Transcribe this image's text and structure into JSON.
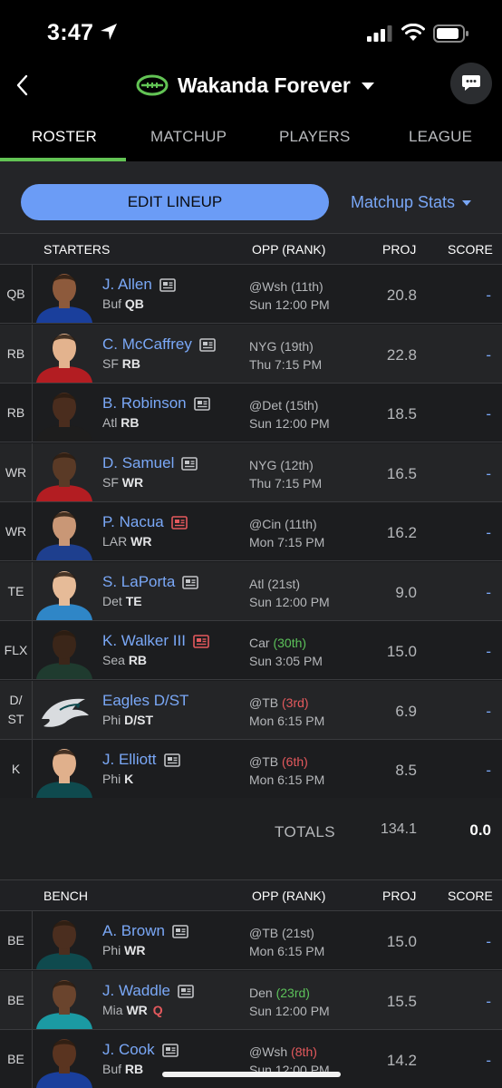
{
  "status_bar": {
    "time": "3:47"
  },
  "header": {
    "team_name": "Wakanda Forever"
  },
  "tabs": [
    {
      "label": "ROSTER",
      "active": true
    },
    {
      "label": "MATCHUP",
      "active": false
    },
    {
      "label": "PLAYERS",
      "active": false
    },
    {
      "label": "LEAGUE",
      "active": false
    }
  ],
  "toolbar": {
    "edit_label": "EDIT LINEUP",
    "stats_label": "Matchup Stats"
  },
  "starters_header": {
    "section": "STARTERS",
    "opp": "OPP (RANK)",
    "proj": "PROJ",
    "score": "SCORE"
  },
  "starters": [
    {
      "slot": "QB",
      "name": "J. Allen",
      "team": "Buf",
      "pos": "QB",
      "news": "normal",
      "opp": "@Wsh",
      "rank": "(11th)",
      "rank_color": "neutral",
      "game": "Sun 12:00 PM",
      "proj": "20.8",
      "score": "-"
    },
    {
      "slot": "RB",
      "name": "C. McCaffrey",
      "team": "SF",
      "pos": "RB",
      "news": "normal",
      "opp": "NYG",
      "rank": "(19th)",
      "rank_color": "neutral",
      "game": "Thu 7:15 PM",
      "proj": "22.8",
      "score": "-"
    },
    {
      "slot": "RB",
      "name": "B. Robinson",
      "team": "Atl",
      "pos": "RB",
      "news": "normal",
      "opp": "@Det",
      "rank": "(15th)",
      "rank_color": "neutral",
      "game": "Sun 12:00 PM",
      "proj": "18.5",
      "score": "-"
    },
    {
      "slot": "WR",
      "name": "D. Samuel",
      "team": "SF",
      "pos": "WR",
      "news": "normal",
      "opp": "NYG",
      "rank": "(12th)",
      "rank_color": "neutral",
      "game": "Thu 7:15 PM",
      "proj": "16.5",
      "score": "-"
    },
    {
      "slot": "WR",
      "name": "P. Nacua",
      "team": "LAR",
      "pos": "WR",
      "news": "red",
      "opp": "@Cin",
      "rank": "(11th)",
      "rank_color": "neutral",
      "game": "Mon 7:15 PM",
      "proj": "16.2",
      "score": "-"
    },
    {
      "slot": "TE",
      "name": "S. LaPorta",
      "team": "Det",
      "pos": "TE",
      "news": "normal",
      "opp": "Atl",
      "rank": "(21st)",
      "rank_color": "neutral",
      "game": "Sun 12:00 PM",
      "proj": "9.0",
      "score": "-"
    },
    {
      "slot": "FLX",
      "name": "K. Walker III",
      "team": "Sea",
      "pos": "RB",
      "news": "red",
      "opp": "Car",
      "rank": "(30th)",
      "rank_color": "good",
      "game": "Sun 3:05 PM",
      "proj": "15.0",
      "score": "-"
    },
    {
      "slot": "D/ ST",
      "name": "Eagles D/ST",
      "team": "Phi",
      "pos": "D/ST",
      "news": "none",
      "opp": "@TB",
      "rank": "(3rd)",
      "rank_color": "bad",
      "game": "Mon 6:15 PM",
      "proj": "6.9",
      "score": "-"
    },
    {
      "slot": "K",
      "name": "J. Elliott",
      "team": "Phi",
      "pos": "K",
      "news": "normal",
      "opp": "@TB",
      "rank": "(6th)",
      "rank_color": "bad",
      "game": "Mon 6:15 PM",
      "proj": "8.5",
      "score": "-"
    }
  ],
  "totals": {
    "label": "TOTALS",
    "proj": "134.1",
    "score": "0.0"
  },
  "bench_header": {
    "section": "BENCH",
    "opp": "OPP (RANK)",
    "proj": "PROJ",
    "score": "SCORE"
  },
  "bench": [
    {
      "slot": "BE",
      "name": "A. Brown",
      "team": "Phi",
      "pos": "WR",
      "status": "",
      "news": "normal",
      "opp": "@TB",
      "rank": "(21st)",
      "rank_color": "neutral",
      "game": "Mon 6:15 PM",
      "proj": "15.0",
      "score": "-"
    },
    {
      "slot": "BE",
      "name": "J. Waddle",
      "team": "Mia",
      "pos": "WR",
      "status": "Q",
      "news": "normal",
      "opp": "Den",
      "rank": "(23rd)",
      "rank_color": "good",
      "game": "Sun 12:00 PM",
      "proj": "15.5",
      "score": "-"
    },
    {
      "slot": "BE",
      "name": "J. Cook",
      "team": "Buf",
      "pos": "RB",
      "status": "",
      "news": "normal",
      "opp": "@Wsh",
      "rank": "(8th)",
      "rank_color": "bad",
      "game": "Sun 12:00 PM",
      "proj": "14.2",
      "score": "-"
    }
  ],
  "colors": {
    "accent_green": "#62c354",
    "link_blue": "#7aa8f7",
    "button_blue": "#6b9cf6",
    "rank_good": "#5cc15a",
    "rank_bad": "#e4595d"
  },
  "icons": {
    "back": "chevron-left-icon",
    "team_logo": "football-icon",
    "chat": "chat-bubble-icon",
    "news": "newspaper-icon",
    "dropdown": "caret-down-icon"
  }
}
